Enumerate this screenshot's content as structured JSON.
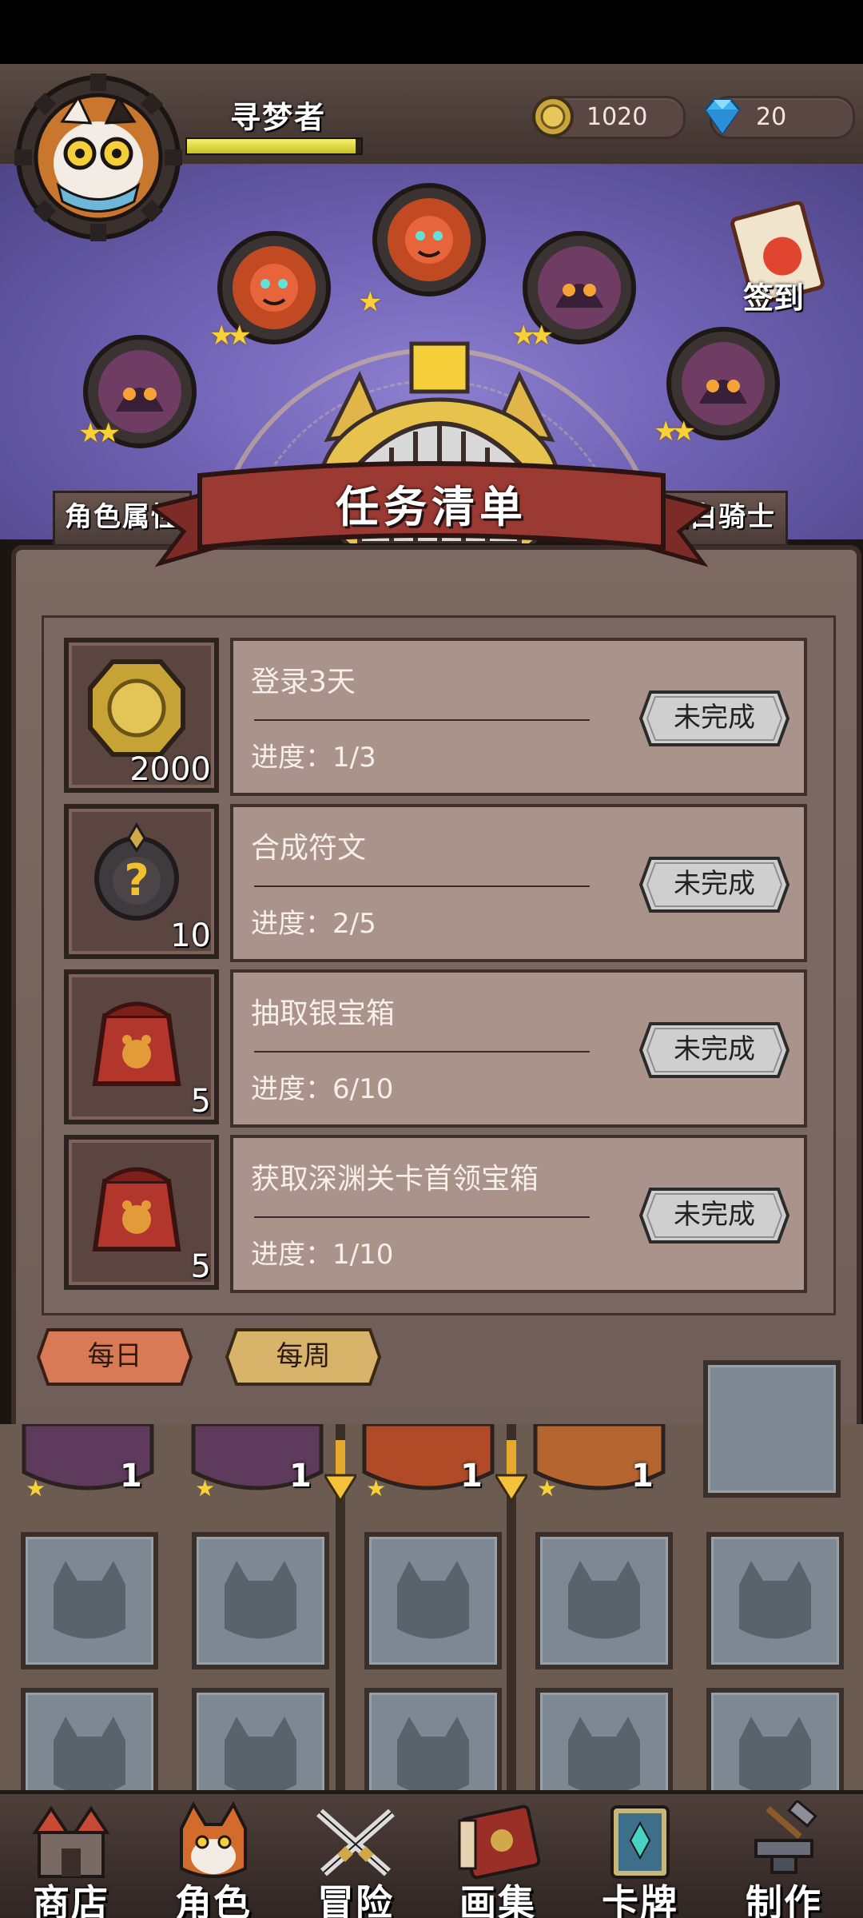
{
  "header": {
    "player_name": "寻梦者",
    "exp_fraction": 0.97,
    "gold": "1020",
    "gems": "20"
  },
  "hero_area": {
    "checkin_label": "签到",
    "left_tab": "角色属性",
    "right_tab": "银白骑士",
    "skill_nodes": [
      {
        "name": "node-1",
        "stars": "★★"
      },
      {
        "name": "node-2",
        "stars": "★★"
      },
      {
        "name": "node-3",
        "stars": "★"
      },
      {
        "name": "node-4",
        "stars": "★★"
      },
      {
        "name": "node-5",
        "stars": "★★"
      }
    ]
  },
  "modal": {
    "title": "任务清单",
    "tasks": [
      {
        "title": "登录3天",
        "progress": "进度：1/3",
        "reward_count": "2000",
        "reward_icon": "gold-coin-icon",
        "button": "未完成"
      },
      {
        "title": "合成符文",
        "progress": "进度：2/5",
        "reward_count": "10",
        "reward_icon": "mystery-rune-icon",
        "button": "未完成"
      },
      {
        "title": "抽取银宝箱",
        "progress": "进度：6/10",
        "reward_count": "5",
        "reward_icon": "red-pouch-icon",
        "button": "未完成"
      },
      {
        "title": "获取深渊关卡首领宝箱",
        "progress": "进度：1/10",
        "reward_count": "5",
        "reward_icon": "red-pouch-icon",
        "button": "未完成"
      }
    ],
    "tabs": {
      "daily": "每日",
      "weekly": "每周"
    }
  },
  "inventory": {
    "top_counts": [
      "1",
      "1",
      "1",
      "1"
    ]
  },
  "nav": {
    "items": [
      {
        "label": "商店",
        "icon": "shop-castle-icon"
      },
      {
        "label": "角色",
        "icon": "cat-character-icon"
      },
      {
        "label": "冒险",
        "icon": "crossed-swords-icon"
      },
      {
        "label": "画集",
        "icon": "art-book-icon"
      },
      {
        "label": "卡牌",
        "icon": "card-deck-icon"
      },
      {
        "label": "制作",
        "icon": "anvil-craft-icon"
      }
    ]
  },
  "colors": {
    "accent_gold": "#f7d03a",
    "panel": "#7b6862",
    "card": "#aa938a",
    "hero_bg": "#6f62b4",
    "daily_tab": "#d97a57",
    "weekly_tab": "#d8b36a"
  }
}
